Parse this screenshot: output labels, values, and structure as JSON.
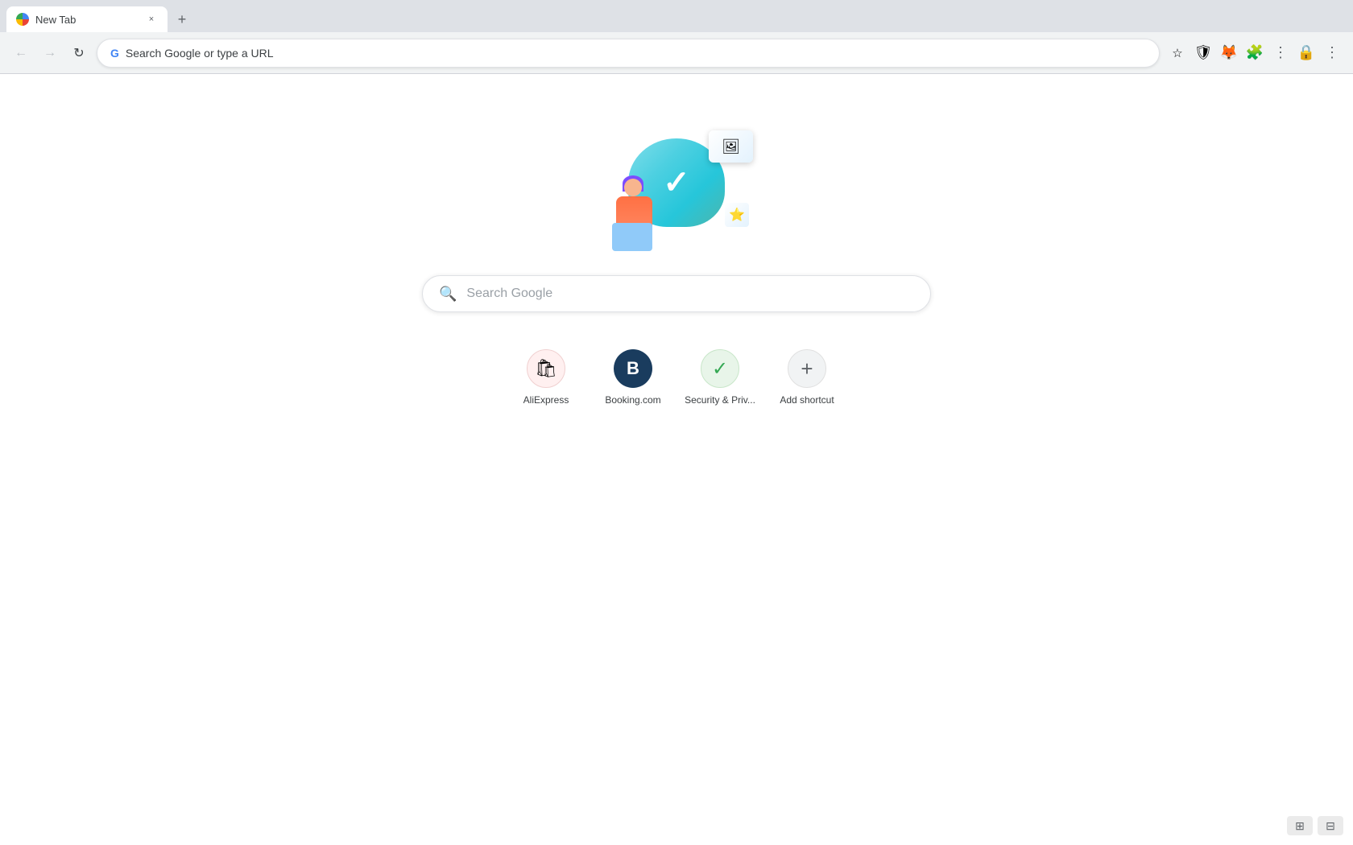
{
  "browser": {
    "tab_title": "New Tab",
    "new_tab_label": "+",
    "address_placeholder": "Search Google or type a URL",
    "address_text": "Search Google or type a URL"
  },
  "toolbar": {
    "back_icon": "←",
    "forward_icon": "→",
    "reload_icon": "↻",
    "bookmark_icon": "☆",
    "menu_icon": "⋮"
  },
  "page": {
    "search_placeholder": "Search Google"
  },
  "shortcuts": [
    {
      "id": "aliexpress",
      "label": "AliExpress",
      "icon_text": "🛍"
    },
    {
      "id": "booking",
      "label": "Booking.com",
      "icon_text": "B"
    },
    {
      "id": "security",
      "label": "Security & Priv...",
      "icon_text": "✓"
    },
    {
      "id": "add-shortcut",
      "label": "Add shortcut",
      "icon_text": "+"
    }
  ],
  "bottom_buttons": {
    "btn1": "⊞",
    "btn2": "⊟"
  }
}
